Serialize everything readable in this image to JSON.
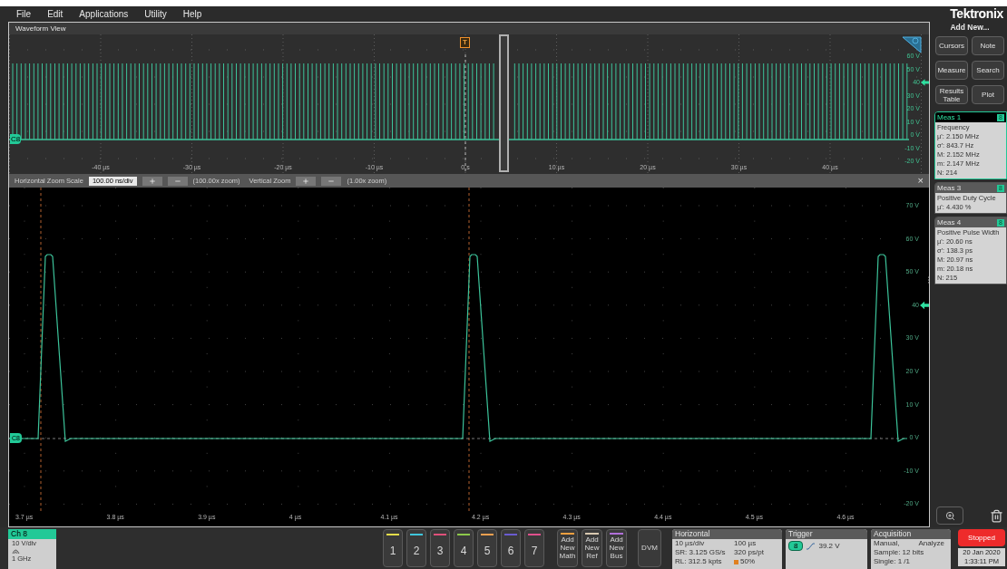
{
  "menu": [
    "File",
    "Edit",
    "Applications",
    "Utility",
    "Help"
  ],
  "brand": "Tektronix",
  "waveform_view": {
    "title": "Waveform View",
    "overview": {
      "trigger_marker": "T",
      "channel_tag": "C8",
      "x_labels": [
        "-40 µs",
        "-30 µs",
        "-20 µs",
        "-10 µs",
        "0 s",
        "10 µs",
        "20 µs",
        "30 µs",
        "40 µs"
      ],
      "y_labels": [
        "60 V",
        "50 V",
        "40",
        "30 V",
        "20 V",
        "10 V",
        "0 V",
        "-10 V",
        "-20 V"
      ]
    },
    "zoom_bar": {
      "h_label": "Horizontal Zoom Scale",
      "h_value": "100.00 ns/div",
      "h_zoom": "(100.00x zoom)",
      "v_label": "Vertical Zoom",
      "v_zoom": "(1.00x zoom)",
      "close": "×"
    },
    "zoom": {
      "channel_tag": "C8",
      "x_labels": [
        "3.7 µs",
        "3.8 µs",
        "3.9 µs",
        "4 µs",
        "4.1 µs",
        "4.2 µs",
        "4.3 µs",
        "4.4 µs",
        "4.5 µs",
        "4.6 µs"
      ],
      "y_labels": [
        "70 V",
        "60 V",
        "50 V",
        "40",
        "30 V",
        "20 V",
        "10 V",
        "0 V",
        "-10 V",
        "-20 V"
      ]
    }
  },
  "side_panel": {
    "title": "Add New...",
    "buttons": [
      "Cursors",
      "Note",
      "Measure",
      "Search",
      "Results Table",
      "Plot"
    ],
    "measurements": [
      {
        "title": "Meas 1",
        "badge": "8",
        "selected": true,
        "lines": [
          "Frequency",
          "µ': 2.150 MHz",
          "σ': 843.7 Hz",
          "M: 2.152 MHz",
          "m: 2.147 MHz",
          "N: 214"
        ]
      },
      {
        "title": "Meas 3",
        "badge": "8",
        "selected": false,
        "lines": [
          "Positive Duty Cycle",
          "µ': 4.430 %"
        ]
      },
      {
        "title": "Meas 4",
        "badge": "8",
        "selected": false,
        "lines": [
          "Positive Pulse Width",
          "µ': 20.60 ns",
          "σ': 138.3 ps",
          "M: 20.97 ns",
          "m: 20.18 ns",
          "N: 215"
        ]
      }
    ]
  },
  "bottom": {
    "channel": {
      "title": "Ch 8",
      "scale": "10 V/div",
      "bandwidth": "1 GHz"
    },
    "channel_buttons": [
      {
        "label": "1",
        "color": "#e3dc4a"
      },
      {
        "label": "2",
        "color": "#3fc6dc"
      },
      {
        "label": "3",
        "color": "#e0507a"
      },
      {
        "label": "4",
        "color": "#8cc84b"
      },
      {
        "label": "5",
        "color": "#f0a050"
      },
      {
        "label": "6",
        "color": "#6a5cd0"
      },
      {
        "label": "7",
        "color": "#e0508c"
      }
    ],
    "add_buttons": [
      {
        "label": "Add New Math",
        "color": "#f0a040"
      },
      {
        "label": "Add New Ref",
        "color": "#d8c8b0"
      },
      {
        "label": "Add New Bus",
        "color": "#b070d8"
      }
    ],
    "dvm": "DVM",
    "horizontal": {
      "title": "Horizontal",
      "rows": [
        [
          "10 µs/div",
          "100 µs"
        ],
        [
          "SR: 3.125 GS/s",
          "320 ps/pt"
        ],
        [
          "RL: 312.5 kpts",
          "50%"
        ]
      ]
    },
    "trigger": {
      "title": "Trigger",
      "source": "8",
      "value": "39.2 V"
    },
    "acquisition": {
      "title": "Acquisition",
      "rows": [
        [
          "Manual,",
          "Analyze"
        ],
        [
          "Sample: 12 bits"
        ],
        [
          "Single: 1 /1"
        ]
      ]
    },
    "run_state": "Stopped",
    "date": "20 Jan 2020",
    "time": "1:33:11 PM"
  }
}
